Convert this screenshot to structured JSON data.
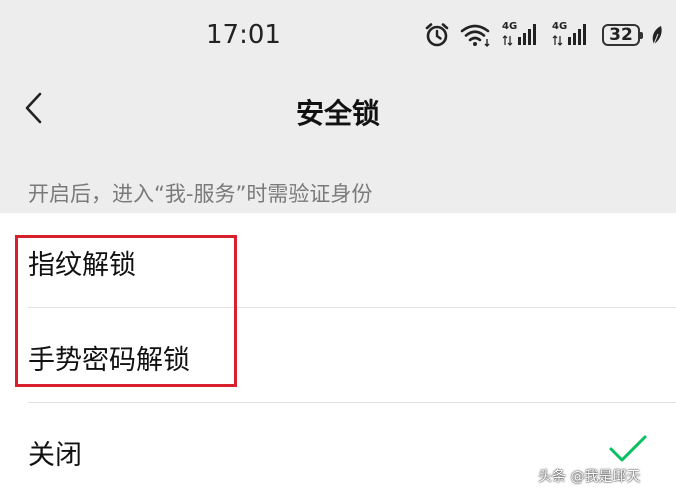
{
  "status_bar": {
    "time": "17:01",
    "network_1": "4G",
    "network_2": "4G",
    "battery": "32",
    "icons": [
      "alarm-icon",
      "wifi-icon",
      "signal-icon",
      "signal-icon",
      "battery-icon",
      "leaf-icon"
    ]
  },
  "header": {
    "title": "安全锁",
    "back_icon": "chevron-left-icon"
  },
  "hint": "开启后，进入“我-服务”时需验证身份",
  "options": [
    {
      "label": "指纹解锁",
      "selected": false
    },
    {
      "label": "手势密码解锁",
      "selected": false
    },
    {
      "label": "关闭",
      "selected": true
    }
  ],
  "colors": {
    "background": "#ededed",
    "card": "#ffffff",
    "accent_check": "#07c160",
    "highlight_box": "#d7202b",
    "hint_text": "#7a7a7a"
  },
  "watermark": "头条 @我是邱天"
}
